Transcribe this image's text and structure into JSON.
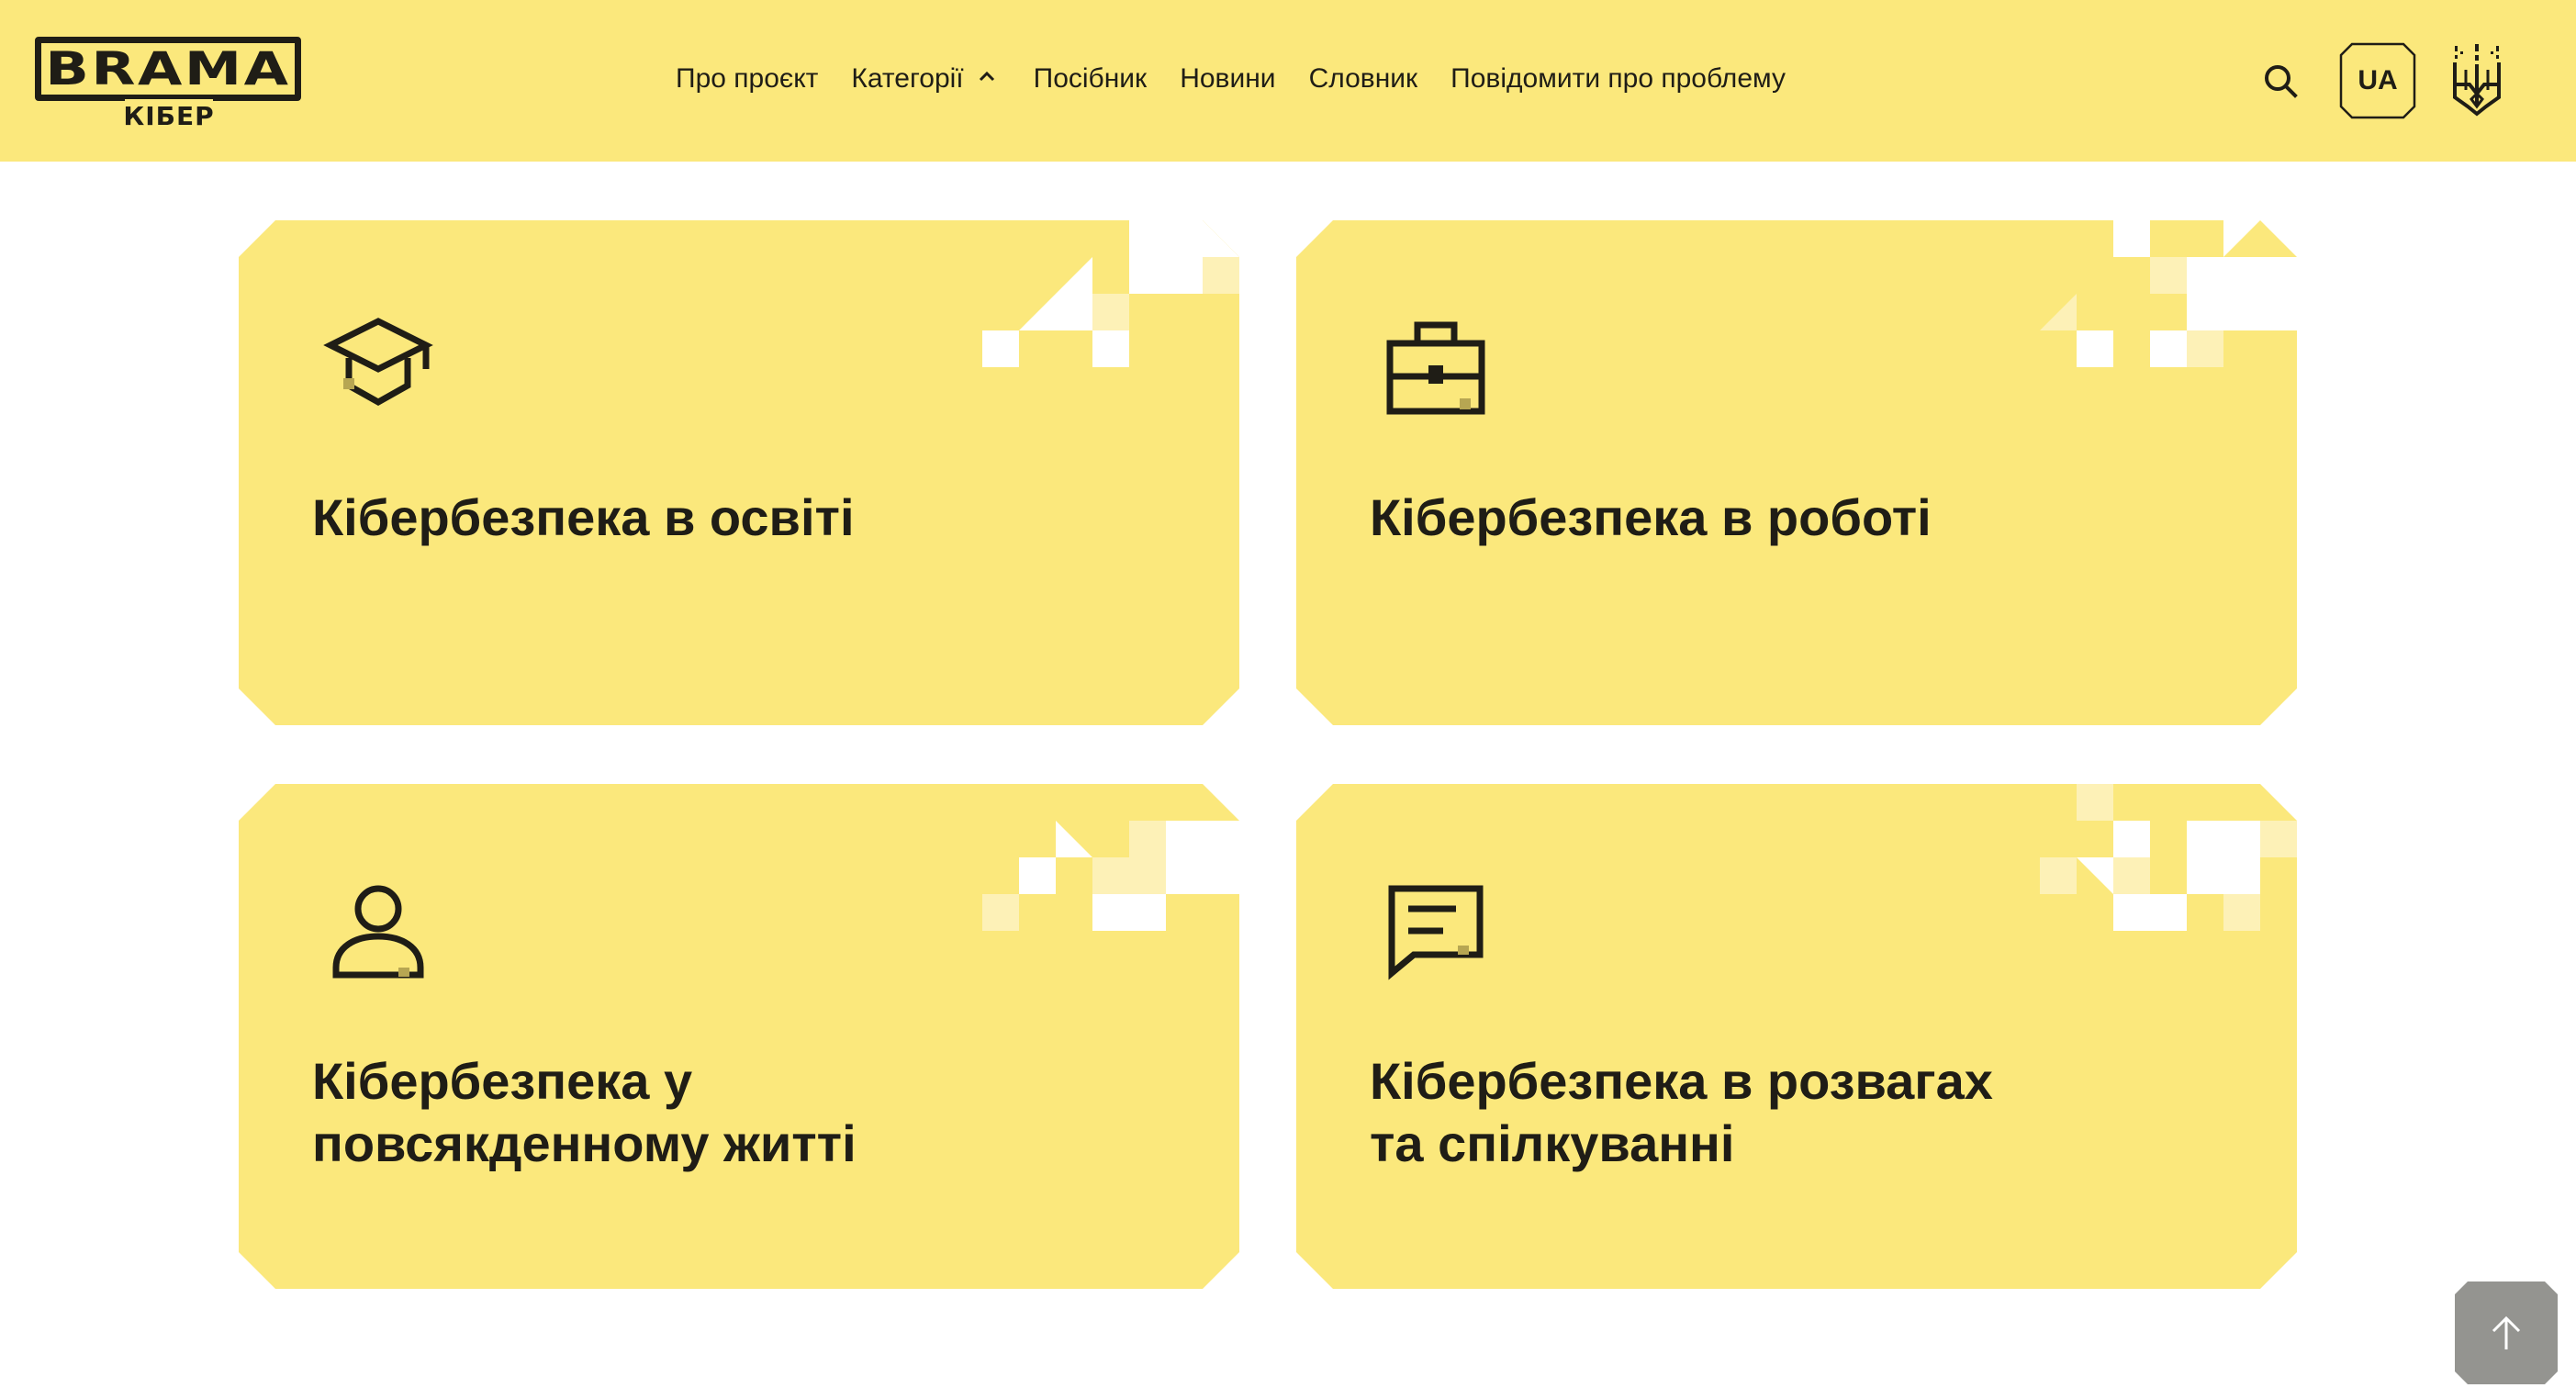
{
  "colors": {
    "header_bg": "#fbe87c",
    "card_bg": "#fbe87c",
    "text": "#1f1d16",
    "to_top_bg": "#949490"
  },
  "logo": {
    "word": "BRAMA",
    "subtitle": "КІБЕР"
  },
  "nav": {
    "items": [
      {
        "label": "Про проєкт"
      },
      {
        "label": "Категорії",
        "icon": "chevron-up-icon"
      },
      {
        "label": "Посібник"
      },
      {
        "label": "Новини"
      },
      {
        "label": "Словник"
      },
      {
        "label": "Повідомити про проблему"
      }
    ]
  },
  "header_actions": {
    "search_icon": "search-icon",
    "language": "UA",
    "emblem_icon": "trident-emblem-icon"
  },
  "cards": [
    {
      "title": "Кібербезпека в освіті",
      "icon": "graduation-cap-icon"
    },
    {
      "title": "Кібербезпека в роботі",
      "icon": "briefcase-icon"
    },
    {
      "title": "Кібербезпека у\nповсякденному житті",
      "icon": "user-icon"
    },
    {
      "title": "Кібербезпека в розвагах\nта спілкуванні",
      "icon": "chat-icon"
    }
  ],
  "scroll_to_top_icon": "arrow-up-icon"
}
